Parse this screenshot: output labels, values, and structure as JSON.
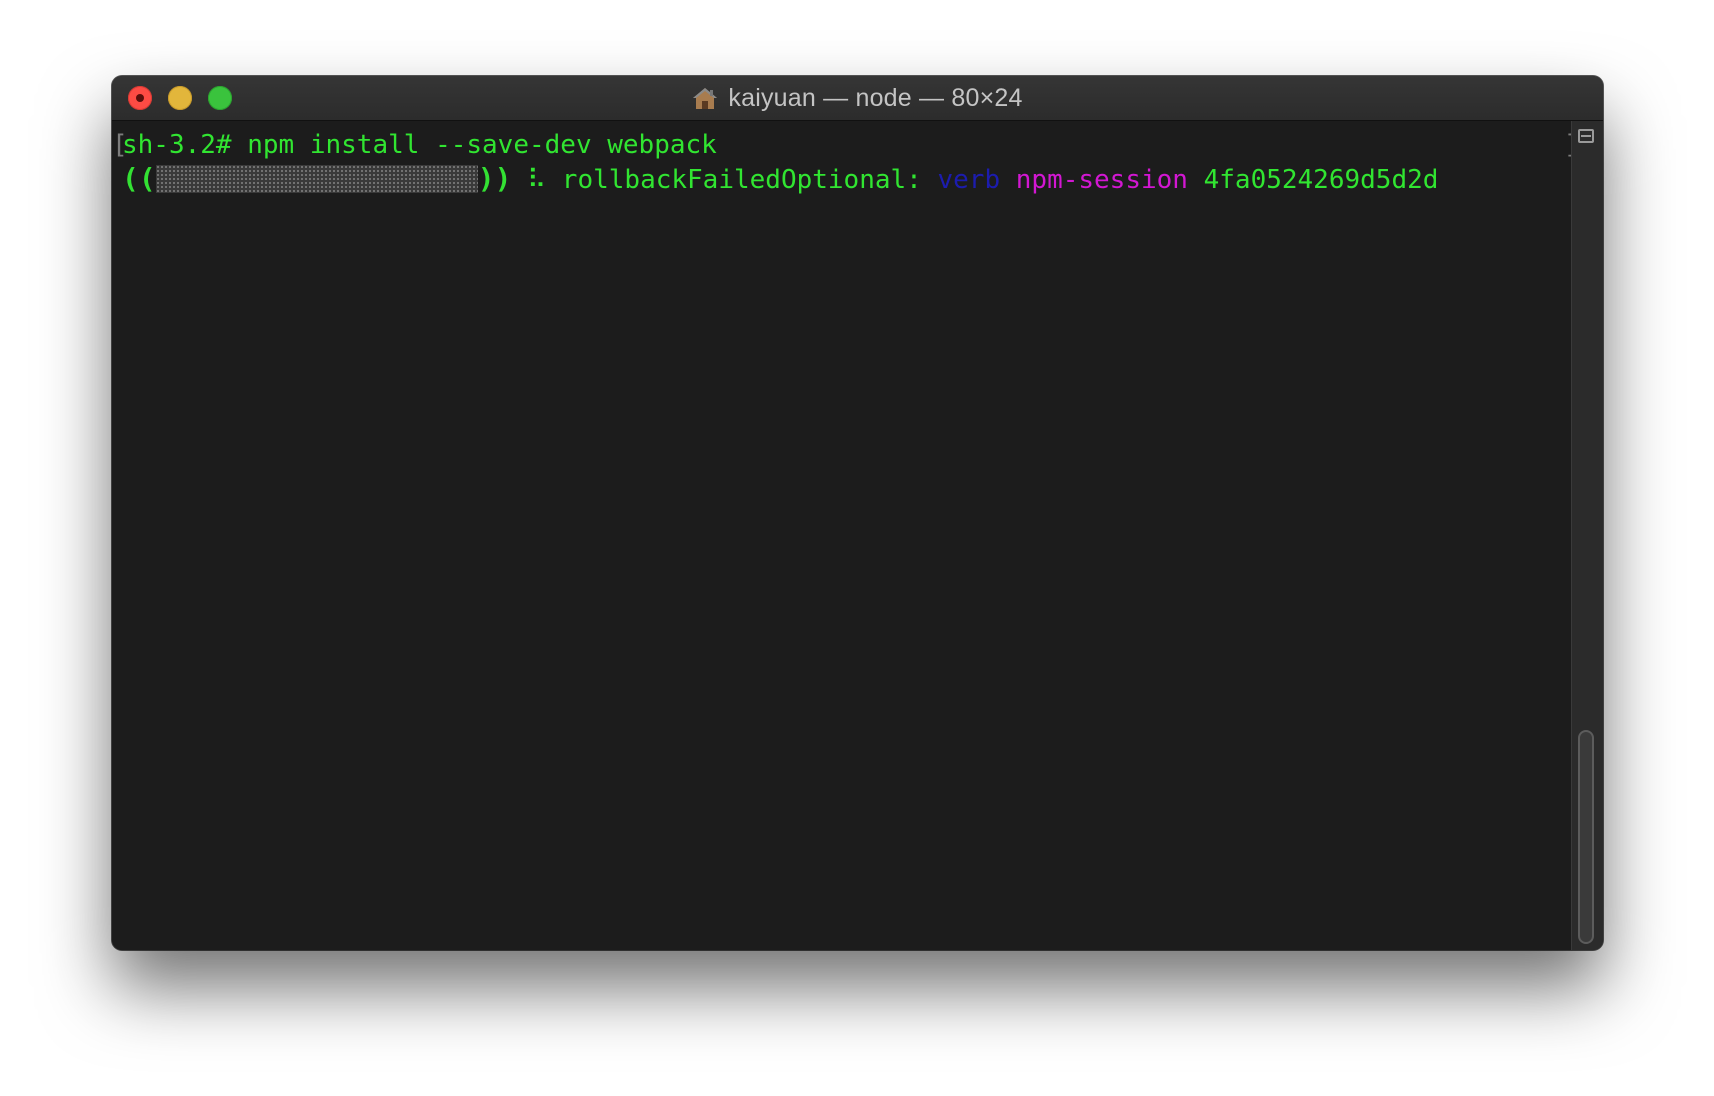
{
  "window": {
    "title": "kaiyuan — node — 80×24",
    "title_icon": "home-icon"
  },
  "traffic_lights": {
    "close_color": "#fd4b44",
    "minimize_color": "#e2b63b",
    "maximize_color": "#3ac33d"
  },
  "terminal": {
    "line1": {
      "open_bracket": "[",
      "command": "sh-3.2# npm install --save-dev webpack",
      "close_bracket": "]"
    },
    "line2": {
      "paren_open": "((",
      "paren_close": "))",
      "spinner": "⠧",
      "stage": "rollbackFailedOptional:",
      "level": "verb",
      "session_label": "npm-session",
      "session_id": "4fa0524269d5d2d"
    },
    "colors": {
      "background": "#1c1c1c",
      "text": "#31e531",
      "verb": "#1c1cae",
      "session": "#d217d2"
    }
  },
  "scrollbar": {
    "split_icon": "split-pane-icon"
  }
}
